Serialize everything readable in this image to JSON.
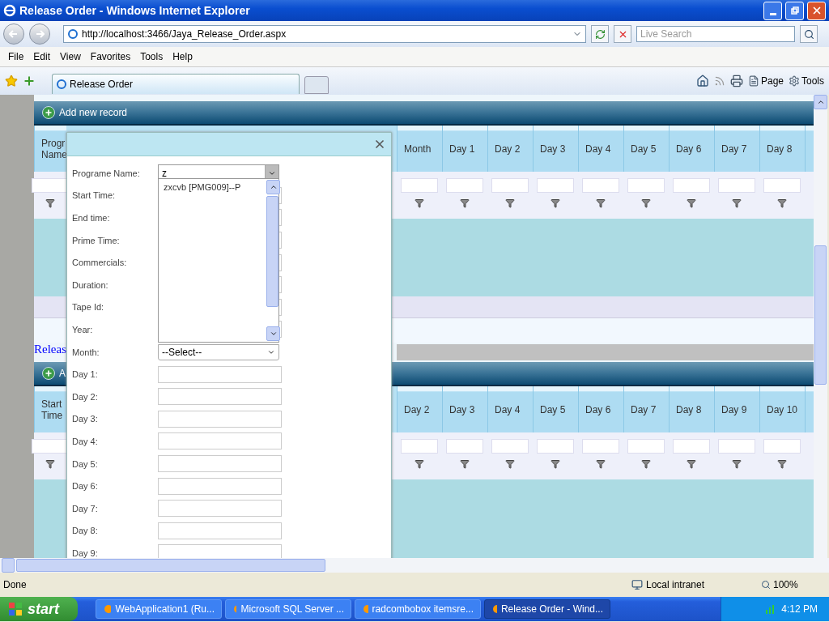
{
  "window": {
    "title": "Release Order - Windows Internet Explorer"
  },
  "address_bar": {
    "url": "http://localhost:3466/Jaya_Release_Order.aspx"
  },
  "search": {
    "placeholder": "Live Search"
  },
  "menu": [
    "File",
    "Edit",
    "View",
    "Favorites",
    "Tools",
    "Help"
  ],
  "tabs": [
    {
      "label": "Release Order",
      "selected": true
    }
  ],
  "command_bar": [
    "Page",
    "Tools"
  ],
  "grids": [
    {
      "add_label": "Add new record",
      "first_column": "Progr Name",
      "columns": [
        "Month",
        "Day 1",
        "Day 2",
        "Day 3",
        "Day 4",
        "Day 5",
        "Day 6",
        "Day 7",
        "Day 8"
      ]
    },
    {
      "add_label": "A",
      "first_column": "Start Time",
      "columns": [
        "Day 2",
        "Day 3",
        "Day 4",
        "Day 5",
        "Day 6",
        "Day 7",
        "Day 8",
        "Day 9",
        "Day 10"
      ]
    }
  ],
  "link": "Releas",
  "dialog": {
    "fields": [
      {
        "label": "Programe Name:",
        "kind": "combo",
        "value": "z",
        "expanded": true
      },
      {
        "label": "Start Time:",
        "kind": "text"
      },
      {
        "label": "End time:",
        "kind": "text"
      },
      {
        "label": "Prime Time:",
        "kind": "text"
      },
      {
        "label": "Commercials:",
        "kind": "text"
      },
      {
        "label": "Duration:",
        "kind": "text"
      },
      {
        "label": "Tape Id:",
        "kind": "text"
      },
      {
        "label": "Year:",
        "kind": "text"
      },
      {
        "label": "Month:",
        "kind": "select",
        "value": "--Select--"
      },
      {
        "label": "Day 1:",
        "kind": "text"
      },
      {
        "label": "Day 2:",
        "kind": "text"
      },
      {
        "label": "Day 3:",
        "kind": "text"
      },
      {
        "label": "Day 4:",
        "kind": "text"
      },
      {
        "label": "Day 5:",
        "kind": "text"
      },
      {
        "label": "Day 6:",
        "kind": "text"
      },
      {
        "label": "Day 7:",
        "kind": "text"
      },
      {
        "label": "Day 8:",
        "kind": "text"
      },
      {
        "label": "Day 9:",
        "kind": "text"
      }
    ],
    "dropdown_items": [
      "zxcvb [PMG009]--P"
    ]
  },
  "status_bar": {
    "text": "Done",
    "zone": "Local intranet",
    "zoom": "100%"
  },
  "taskbar": {
    "start": "start",
    "tasks": [
      {
        "label": "WebApplication1 (Ru...",
        "selected": false
      },
      {
        "label": "Microsoft SQL Server ...",
        "selected": false
      },
      {
        "label": "radcombobox itemsre...",
        "selected": false
      },
      {
        "label": "Release Order - Wind...",
        "selected": true
      }
    ],
    "clock": "4:12 PM"
  }
}
